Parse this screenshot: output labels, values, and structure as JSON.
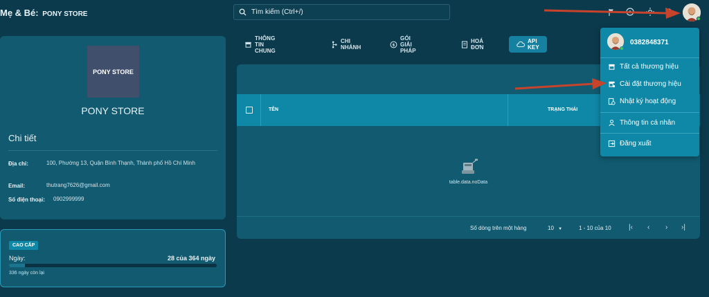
{
  "header": {
    "brand": "Mẹ & Bé:",
    "store": "PONY STORE",
    "search_placeholder": "Tìm kiếm (Ctrl+/)"
  },
  "profile": {
    "logo_text": "PONY STORE",
    "name": "PONY STORE",
    "detail_title": "Chi tiết",
    "address_label": "Địa chỉ:",
    "address_value": "100, Phường 13, Quận Bình Thạnh, Thành phố Hồ Chí Minh",
    "email_label": "Email:",
    "email_value": "thutrang7626@gmail.com",
    "phone_label": "Số điện thoại:",
    "phone_value": "0902999999"
  },
  "plan": {
    "badge": "CAO CẤP",
    "days_label": "Ngày:",
    "days_count": "28 của 364 ngày",
    "progress_fraction": 0.077,
    "remaining": "336 ngày còn lại"
  },
  "tabs": [
    {
      "label": "THÔNG TIN CHUNG",
      "icon": "store-icon"
    },
    {
      "label": "CHI NHÁNH",
      "icon": "branch-icon"
    },
    {
      "label": "GÓI GIẢI PHÁP",
      "icon": "package-icon"
    },
    {
      "label": "HOÁ ĐƠN",
      "icon": "invoice-icon"
    },
    {
      "label": "API KEY",
      "icon": "cloud-icon",
      "active": true
    }
  ],
  "table": {
    "col_name": "TÊN",
    "col_status": "TRẠNG THÁI",
    "no_data": "table.data.noData",
    "rows_per_page_label": "Số dòng trên một hàng",
    "rows_per_page_value": "10",
    "range": "1 - 10 của 10"
  },
  "menu": {
    "phone": "0382848371",
    "items": [
      {
        "label": "Tất cả thương hiệu",
        "icon": "store-icon"
      },
      {
        "label": "Cài đặt thương hiệu",
        "icon": "store-settings-icon"
      },
      {
        "label": "Nhật ký hoạt động",
        "icon": "activity-log-icon"
      },
      {
        "label": "Thông tin cá nhân",
        "icon": "user-icon"
      },
      {
        "label": "Đăng xuất",
        "icon": "logout-icon"
      }
    ]
  },
  "colors": {
    "background": "#0c3a4d",
    "card": "#115a70",
    "accent": "#0f88a7",
    "annotation_arrow": "#c8432b",
    "online": "#41c463"
  }
}
